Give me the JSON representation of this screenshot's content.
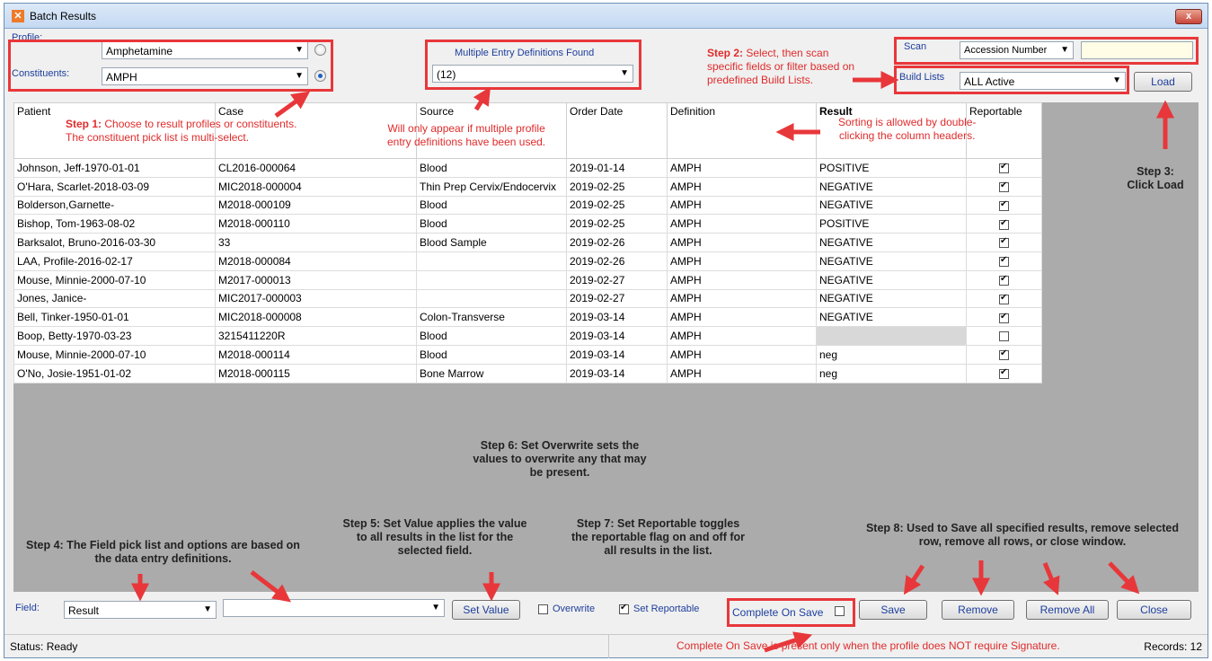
{
  "window": {
    "title": "Batch Results",
    "close_glyph": "x"
  },
  "top": {
    "profile_label": "Profile:",
    "profile_value": "Amphetamine",
    "constituents_label": "Constituents:",
    "constituents_value": "AMPH",
    "multi_def_label": "Multiple Entry Definitions Found",
    "multi_def_value": "(12)",
    "scan_label": "Scan",
    "scan_type_value": "Accession Number",
    "scan_input_value": "",
    "build_lists_label": "Build Lists",
    "build_lists_value": "ALL Active",
    "load_label": "Load"
  },
  "grid": {
    "columns": [
      "Patient",
      "Case",
      "Source",
      "Order Date",
      "Definition",
      "Result",
      "Reportable"
    ],
    "rows": [
      {
        "patient": "Johnson, Jeff-1970-01-01",
        "case": "CL2016-000064",
        "source": "Blood",
        "order_date": "2019-01-14",
        "definition": "AMPH",
        "result": "POSITIVE",
        "reportable": true
      },
      {
        "patient": "O'Hara, Scarlet-2018-03-09",
        "case": "MIC2018-000004",
        "source": "Thin Prep Cervix/Endocervix",
        "order_date": "2019-02-25",
        "definition": "AMPH",
        "result": "NEGATIVE",
        "reportable": true
      },
      {
        "patient": "Bolderson,Garnette-",
        "case": "M2018-000109",
        "source": "Blood",
        "order_date": "2019-02-25",
        "definition": "AMPH",
        "result": "NEGATIVE",
        "reportable": true
      },
      {
        "patient": "Bishop, Tom-1963-08-02",
        "case": "M2018-000110",
        "source": "Blood",
        "order_date": "2019-02-25",
        "definition": "AMPH",
        "result": "POSITIVE",
        "reportable": true
      },
      {
        "patient": "Barksalot, Bruno-2016-03-30",
        "case": "33",
        "source": "Blood Sample",
        "order_date": "2019-02-26",
        "definition": "AMPH",
        "result": "NEGATIVE",
        "reportable": true
      },
      {
        "patient": "LAA, Profile-2016-02-17",
        "case": "M2018-000084",
        "source": "",
        "order_date": "2019-02-26",
        "definition": "AMPH",
        "result": "NEGATIVE",
        "reportable": true
      },
      {
        "patient": "Mouse, Minnie-2000-07-10",
        "case": "M2017-000013",
        "source": "",
        "order_date": "2019-02-27",
        "definition": "AMPH",
        "result": "NEGATIVE",
        "reportable": true
      },
      {
        "patient": "Jones, Janice-",
        "case": "MIC2017-000003",
        "source": "",
        "order_date": "2019-02-27",
        "definition": "AMPH",
        "result": "NEGATIVE",
        "reportable": true
      },
      {
        "patient": "Bell, Tinker-1950-01-01",
        "case": "MIC2018-000008",
        "source": "Colon-Transverse",
        "order_date": "2019-03-14",
        "definition": "AMPH",
        "result": "NEGATIVE",
        "reportable": true
      },
      {
        "patient": "Boop, Betty-1970-03-23",
        "case": "3215411220R",
        "source": "Blood",
        "order_date": "2019-03-14",
        "definition": "AMPH",
        "result": "",
        "reportable": false
      },
      {
        "patient": "Mouse, Minnie-2000-07-10",
        "case": "M2018-000114",
        "source": "Blood",
        "order_date": "2019-03-14",
        "definition": "AMPH",
        "result": "neg",
        "reportable": true
      },
      {
        "patient": "O'No, Josie-1951-01-02",
        "case": "M2018-000115",
        "source": "Bone Marrow",
        "order_date": "2019-03-14",
        "definition": "AMPH",
        "result": "neg",
        "reportable": true
      }
    ]
  },
  "bottom": {
    "field_label": "Field:",
    "field_value": "Result",
    "value_input": "",
    "set_value_label": "Set Value",
    "overwrite_label": "Overwrite",
    "overwrite_checked": false,
    "set_reportable_label": "Set Reportable",
    "set_reportable_checked": true,
    "complete_on_save_label": "Complete On Save",
    "save_label": "Save",
    "remove_label": "Remove",
    "remove_all_label": "Remove All",
    "close_label": "Close"
  },
  "status": {
    "left": "Status: Ready",
    "right": "Records: 12"
  },
  "annotations": {
    "step1_lead": "Step 1:",
    "step1_text": " Choose to result profiles or constituents.",
    "step1_line2": "The constituent pick list is multi-select.",
    "multi_note_1": "Will only appear if multiple profile",
    "multi_note_2": "entry definitions have been used.",
    "step2_lead": "Step 2:",
    "step2_text": " Select, then scan",
    "step2_line2": "specific fields or filter based on",
    "step2_line3": "predefined Build Lists.",
    "sort_note_1": "Sorting is allowed by double-",
    "sort_note_2": "clicking the column headers.",
    "step3_1": "Step 3:",
    "step3_2": "Click Load",
    "step4": "Step 4: The Field pick list and options are based on the data entry definitions.",
    "step5": "Step 5: Set Value applies the value to all results in the list for the selected field.",
    "step6": "Step 6: Set Overwrite sets the values to overwrite any that may be present.",
    "step7": "Step 7: Set Reportable toggles the reportable flag on and off for all results in the list.",
    "step8": "Step 8: Used to Save all specified results, remove selected row, remove all rows, or close window.",
    "complete_note": "Complete On Save is present only when the profile does NOT require Signature."
  },
  "colors": {
    "annotation_red": "#e8373a",
    "grid_bg": "#ababab",
    "label_blue": "#1d3e9c"
  }
}
